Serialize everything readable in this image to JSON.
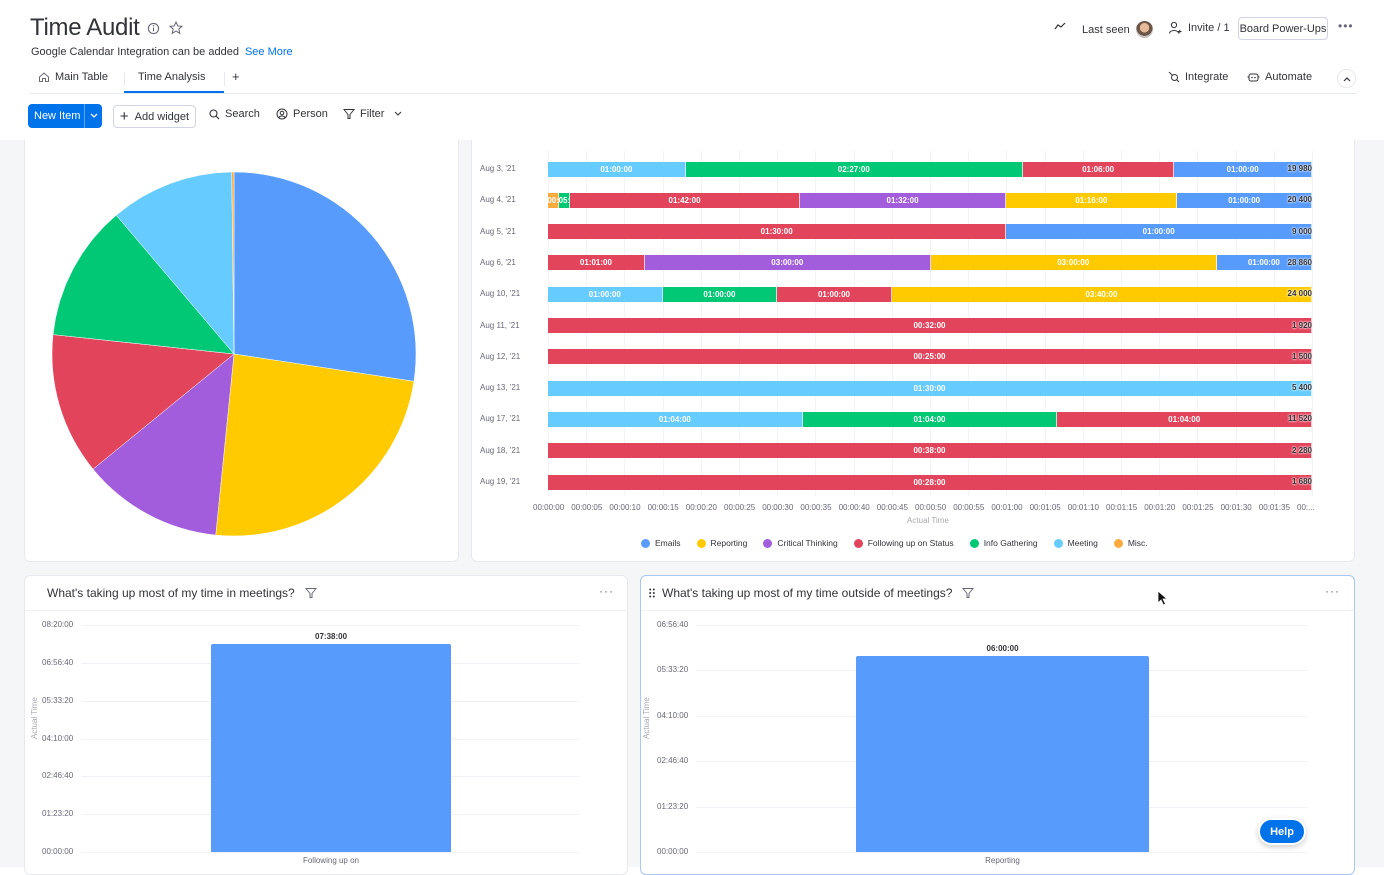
{
  "header": {
    "title": "Time Audit",
    "subtitle": "Google Calendar Integration can be added",
    "see_more": "See More",
    "last_seen": "Last seen",
    "invite": "Invite / 1",
    "board_powerups": "Board Power-Ups",
    "more": "•••"
  },
  "tabs": [
    {
      "label": "Main Table",
      "icon": "home-icon"
    },
    {
      "label": "Time Analysis",
      "active": true
    },
    {
      "label": "+"
    }
  ],
  "tab_actions": {
    "integrate": "Integrate",
    "automate": "Automate"
  },
  "toolbar": {
    "new_item": "New Item",
    "add_widget": "Add widget",
    "search": "Search",
    "person": "Person",
    "filter": "Filter"
  },
  "colors": {
    "Emails": "#579bfc",
    "Reporting": "#ffcb00",
    "Critical Thinking": "#a25ddc",
    "Following up on Status": "#e2445c",
    "Info Gathering": "#00c875",
    "Meeting": "#66ccff",
    "Misc.": "#fdab3d",
    "accent": "#0073ea"
  },
  "chart_data": [
    {
      "type": "pie",
      "title": "",
      "slices": [
        {
          "label": "Emails",
          "value": 27.4
        },
        {
          "label": "Reporting",
          "value": 24.2
        },
        {
          "label": "Critical Thinking",
          "value": 12.5
        },
        {
          "label": "Following up on Status",
          "value": 12.6
        },
        {
          "label": "Info Gathering",
          "value": 12.1
        },
        {
          "label": "Meeting",
          "value": 11.0
        },
        {
          "label": "Misc.",
          "value": 0.2
        }
      ]
    },
    {
      "type": "bar",
      "orientation": "horizontal-stacked",
      "xlabel": "Actual Time",
      "xticks": [
        "00:00:00",
        "00:00:05",
        "00:00:10",
        "00:00:15",
        "00:00:20",
        "00:00:25",
        "00:00:30",
        "00:00:35",
        "00:00:40",
        "00:00:45",
        "00:00:50",
        "00:00:55",
        "00:01:00",
        "00:01:05",
        "00:01:10",
        "00:01:15",
        "00:01:20",
        "00:01:25",
        "00:01:30",
        "00:01:35",
        "00:..."
      ],
      "legend": [
        "Emails",
        "Reporting",
        "Critical Thinking",
        "Following up on Status",
        "Info Gathering",
        "Meeting",
        "Misc."
      ],
      "legend_position": "bottom",
      "rows": [
        {
          "date": "Aug 3, '21",
          "total": "19 980",
          "segments": [
            {
              "category": "Meeting",
              "label": "01:00:00",
              "seconds": 3600
            },
            {
              "category": "Info Gathering",
              "label": "02:27:00",
              "seconds": 8820
            },
            {
              "category": "Following up on Status",
              "label": "01:06:00",
              "seconds": 3960
            },
            {
              "category": "Emails",
              "label": "01:00:00",
              "seconds": 3600
            }
          ]
        },
        {
          "date": "Aug 4, '21",
          "total": "20 400",
          "segments": [
            {
              "category": "Misc.",
              "label": "00:",
              "seconds": 300
            },
            {
              "category": "Info Gathering",
              "label": "05:",
              "seconds": 300
            },
            {
              "category": "Following up on Status",
              "label": "01:42:00",
              "seconds": 6120
            },
            {
              "category": "Critical Thinking",
              "label": "01:32:00",
              "seconds": 5520
            },
            {
              "category": "Reporting",
              "label": "01:16:00",
              "seconds": 4560
            },
            {
              "category": "Emails",
              "label": "01:00:00",
              "seconds": 3600
            }
          ]
        },
        {
          "date": "Aug 5, '21",
          "total": "9 000",
          "segments": [
            {
              "category": "Following up on Status",
              "label": "01:30:00",
              "seconds": 5400
            },
            {
              "category": "Emails",
              "label": "01:00:00",
              "seconds": 3600
            }
          ]
        },
        {
          "date": "Aug 6, '21",
          "total": "28 860",
          "segments": [
            {
              "category": "Following up on Status",
              "label": "01:01:00",
              "seconds": 3660
            },
            {
              "category": "Critical Thinking",
              "label": "03:00:00",
              "seconds": 10800
            },
            {
              "category": "Reporting",
              "label": "03:00:00",
              "seconds": 10800
            },
            {
              "category": "Emails",
              "label": "01:00:00",
              "seconds": 3600
            }
          ]
        },
        {
          "date": "Aug 10, '21",
          "total": "24 000",
          "segments": [
            {
              "category": "Meeting",
              "label": "01:00:00",
              "seconds": 3600
            },
            {
              "category": "Info Gathering",
              "label": "01:00:00",
              "seconds": 3600
            },
            {
              "category": "Following up on Status",
              "label": "01:00:00",
              "seconds": 3600
            },
            {
              "category": "Reporting",
              "label": "03:40:00",
              "seconds": 13200
            }
          ]
        },
        {
          "date": "Aug 11, '21",
          "total": "1 920",
          "segments": [
            {
              "category": "Following up on Status",
              "label": "00:32:00",
              "seconds": 1920
            }
          ]
        },
        {
          "date": "Aug 12, '21",
          "total": "1 500",
          "segments": [
            {
              "category": "Following up on Status",
              "label": "00:25:00",
              "seconds": 1500
            }
          ]
        },
        {
          "date": "Aug 13, '21",
          "total": "5 400",
          "segments": [
            {
              "category": "Meeting",
              "label": "01:30:00",
              "seconds": 5400
            }
          ]
        },
        {
          "date": "Aug 17, '21",
          "total": "11 520",
          "segments": [
            {
              "category": "Meeting",
              "label": "01:04:00",
              "seconds": 3840
            },
            {
              "category": "Info Gathering",
              "label": "01:04:00",
              "seconds": 3840
            },
            {
              "category": "Following up on Status",
              "label": "01:04:00",
              "seconds": 3840
            }
          ]
        },
        {
          "date": "Aug 18, '21",
          "total": "2 280",
          "segments": [
            {
              "category": "Following up on Status",
              "label": "00:38:00",
              "seconds": 2280
            }
          ]
        },
        {
          "date": "Aug 19, '21",
          "total": "1 680",
          "segments": [
            {
              "category": "Following up on Status",
              "label": "00:28:00",
              "seconds": 1680
            }
          ]
        }
      ]
    },
    {
      "type": "bar",
      "title": "What's taking up most of my time in meetings?",
      "ylabel": "Actual Time",
      "yticks": [
        "00:00:00",
        "01:23:20",
        "02:46:40",
        "04:10:00",
        "05:33:20",
        "06:56:40",
        "08:20:00"
      ],
      "ylim_seconds": [
        0,
        30000
      ],
      "categories": [
        "Following up on St..."
      ],
      "values_seconds": [
        27480
      ],
      "value_labels": [
        "07:38:00"
      ]
    },
    {
      "type": "bar",
      "title": "What's taking up most of my time outside of meetings?",
      "ylabel": "Actual Time",
      "yticks": [
        "00:00:00",
        "01:23:20",
        "02:46:40",
        "04:10:00",
        "05:33:20",
        "06:56:40"
      ],
      "ylim_seconds": [
        0,
        25000
      ],
      "categories": [
        "Reporting"
      ],
      "values_seconds": [
        21600
      ],
      "value_labels": [
        "06:00:00"
      ]
    }
  ],
  "help": "Help"
}
